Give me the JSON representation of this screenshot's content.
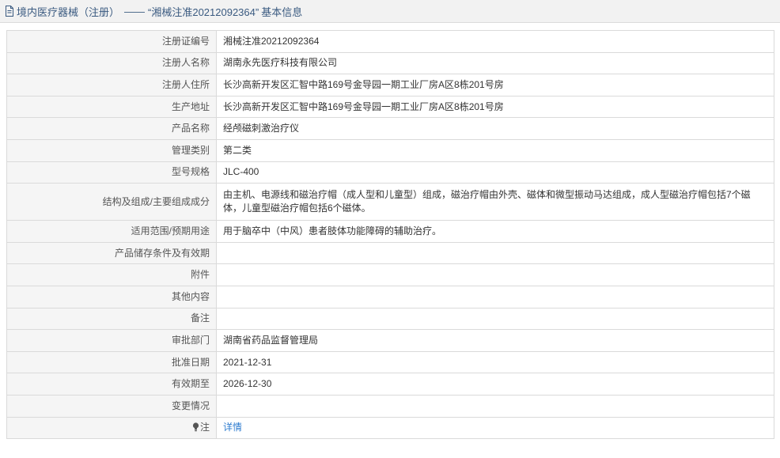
{
  "header": {
    "category": "境内医疗器械（注册）",
    "separator": "——",
    "record_title": "“湘械注准20212092364”",
    "suffix": "基本信息"
  },
  "rows": [
    {
      "label": "注册证编号",
      "value": "湘械注准20212092364"
    },
    {
      "label": "注册人名称",
      "value": "湖南永先医疗科技有限公司"
    },
    {
      "label": "注册人住所",
      "value": "长沙高新开发区汇智中路169号金导园一期工业厂房A区8栋201号房"
    },
    {
      "label": "生产地址",
      "value": "长沙高新开发区汇智中路169号金导园一期工业厂房A区8栋201号房"
    },
    {
      "label": "产品名称",
      "value": "经颅磁刺激治疗仪"
    },
    {
      "label": "管理类别",
      "value": "第二类"
    },
    {
      "label": "型号规格",
      "value": "JLC-400"
    },
    {
      "label": "结构及组成/主要组成成分",
      "value": "由主机、电源线和磁治疗帽（成人型和儿童型）组成，磁治疗帽由外壳、磁体和微型振动马达组成，成人型磁治疗帽包括7个磁体，儿童型磁治疗帽包括6个磁体。"
    },
    {
      "label": "适用范围/预期用途",
      "value": "用于脑卒中（中风）患者肢体功能障碍的辅助治疗。"
    },
    {
      "label": "产品储存条件及有效期",
      "value": ""
    },
    {
      "label": "附件",
      "value": ""
    },
    {
      "label": "其他内容",
      "value": ""
    },
    {
      "label": "备注",
      "value": ""
    },
    {
      "label": "审批部门",
      "value": "湖南省药品监督管理局"
    },
    {
      "label": "批准日期",
      "value": "2021-12-31"
    },
    {
      "label": "有效期至",
      "value": "2026-12-30"
    },
    {
      "label": "变更情况",
      "value": ""
    }
  ],
  "note_row": {
    "label": "注",
    "link_text": "详情",
    "icon": "lightbulb-icon"
  },
  "colors": {
    "link": "#2e7ccf",
    "label_bg": "#f5f5f5",
    "header_bg": "#f2f2f2",
    "header_text": "#3a5a80"
  }
}
